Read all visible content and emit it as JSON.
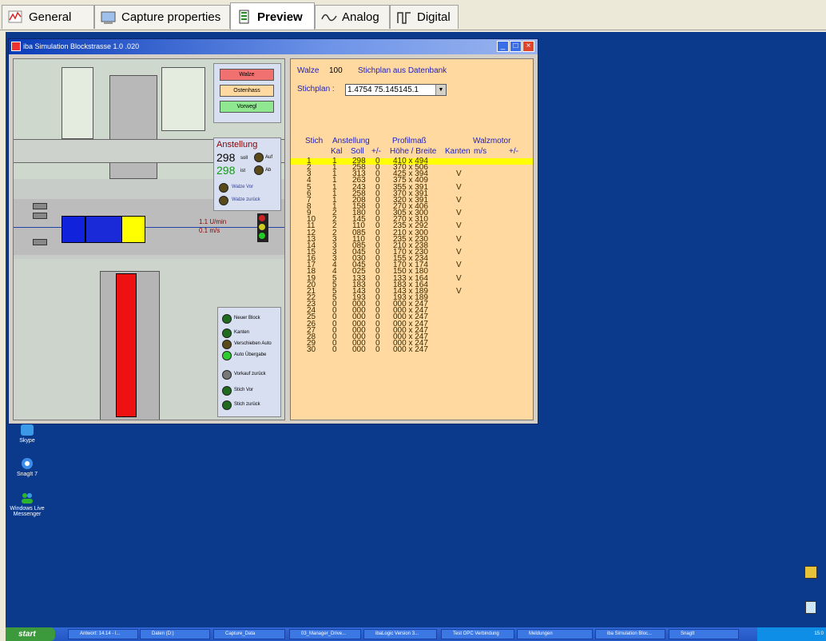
{
  "tabs": [
    {
      "label": "General",
      "icon": "general-icon"
    },
    {
      "label": "Capture properties",
      "icon": "capture-icon"
    },
    {
      "label": "Preview",
      "icon": "preview-icon",
      "active": true
    },
    {
      "label": "Analog",
      "icon": "analog-icon"
    },
    {
      "label": "Digital",
      "icon": "digital-icon"
    }
  ],
  "window": {
    "title": "iba Simulation Blockstrasse 1.0 .020"
  },
  "mill": {
    "buttons": [
      "Walze",
      "Ostenhass",
      "Vorwegl"
    ],
    "anstellung_title": "Anstellung",
    "soll_value": "298",
    "soll_label": "soll",
    "ist_value": "298",
    "ist_label": "ist",
    "auf_label": "Auf",
    "ab_label": "Ab",
    "walze_vor": "Walze Vor",
    "walze_zurueck": "Walze zurück",
    "speed_text": "1.1 U/min",
    "speed_ms": "0.1 m/s",
    "controls": [
      "Neuer Block",
      "Kanten",
      "Verschieben Auto",
      "Auto Übergabe",
      "Vorkauf zurück",
      "Stich Vor",
      "Stich zurück"
    ]
  },
  "stichplan": {
    "walze_label": "Walze",
    "walze_value": "100",
    "title": "Stichplan aus Datenbank",
    "dropdown_label": "Stichplan :",
    "dropdown_value": "1.4754 75.145145.1",
    "header1": {
      "stich": "Stich",
      "anstellung": "Anstellung",
      "profilmass": "Profilmaß",
      "walzmotor": "Walzmotor"
    },
    "header2": {
      "kal": "Kal",
      "soll": "Soll",
      "pm": "+/-",
      "hb": "Höhe / Breite",
      "kanten": "Kanten",
      "ms": "m/s",
      "pm2": "+/-"
    },
    "rows": [
      [
        "1",
        "1",
        "298",
        "0",
        "410 x 494",
        ""
      ],
      [
        "2",
        "1",
        "258",
        "0",
        "370 x 506",
        ""
      ],
      [
        "3",
        "1",
        "313",
        "0",
        "425 x 394",
        "V"
      ],
      [
        "4",
        "1",
        "263",
        "0",
        "375 x 409",
        ""
      ],
      [
        "5",
        "1",
        "243",
        "0",
        "355 x 391",
        "V"
      ],
      [
        "6",
        "1",
        "258",
        "0",
        "370 x 391",
        ""
      ],
      [
        "7",
        "1",
        "208",
        "0",
        "320 x 391",
        "V"
      ],
      [
        "8",
        "1",
        "158",
        "0",
        "270 x 406",
        ""
      ],
      [
        "9",
        "2",
        "180",
        "0",
        "305 x 300",
        "V"
      ],
      [
        "10",
        "2",
        "145",
        "0",
        "270 x 310",
        ""
      ],
      [
        "11",
        "2",
        "110",
        "0",
        "235 x 292",
        "V"
      ],
      [
        "12",
        "2",
        "085",
        "0",
        "210 x 300",
        ""
      ],
      [
        "13",
        "3",
        "110",
        "0",
        "235 x 230",
        "V"
      ],
      [
        "14",
        "3",
        "085",
        "0",
        "210 x 238",
        ""
      ],
      [
        "15",
        "3",
        "045",
        "0",
        "170 x 230",
        "V"
      ],
      [
        "16",
        "3",
        "030",
        "0",
        "155 x 234",
        ""
      ],
      [
        "17",
        "4",
        "045",
        "0",
        "170 x 174",
        "V"
      ],
      [
        "18",
        "4",
        "025",
        "0",
        "150 x 180",
        ""
      ],
      [
        "19",
        "5",
        "133",
        "0",
        "133 x 164",
        "V"
      ],
      [
        "20",
        "5",
        "183",
        "0",
        "183 x 164",
        ""
      ],
      [
        "21",
        "5",
        "143",
        "0",
        "143 x 189",
        "V"
      ],
      [
        "22",
        "5",
        "193",
        "0",
        "193 x 189",
        ""
      ],
      [
        "23",
        "0",
        "000",
        "0",
        "000 x 247",
        ""
      ],
      [
        "24",
        "0",
        "000",
        "0",
        "000 x 247",
        ""
      ],
      [
        "25",
        "0",
        "000",
        "0",
        "000 x 247",
        ""
      ],
      [
        "26",
        "0",
        "000",
        "0",
        "000 x 247",
        ""
      ],
      [
        "27",
        "0",
        "000",
        "0",
        "000 x 247",
        ""
      ],
      [
        "28",
        "0",
        "000",
        "0",
        "000 x 247",
        ""
      ],
      [
        "29",
        "0",
        "000",
        "0",
        "000 x 247",
        ""
      ],
      [
        "30",
        "0",
        "000",
        "0",
        "000 x 247",
        ""
      ]
    ]
  },
  "desktop_icons": [
    {
      "label": "Skype",
      "icon": "skype-icon"
    },
    {
      "label": "SnagIt 7",
      "icon": "snagit-icon"
    },
    {
      "label": "Windows Live Messenger",
      "icon": "messenger-icon"
    }
  ],
  "taskbar": {
    "start": "start",
    "items": [
      "Antwort: 14.14 - l...",
      "Daten (D:)",
      "Capture_Data",
      "03_Manager_Drive...",
      "ibaLogic Version 3...",
      "Test OPC Verbindung",
      "Meldungen",
      "iba Simulation Bloc...",
      "SnagIt"
    ],
    "clock": "15:0"
  },
  "colors": {
    "desktop": "#0b3a8c",
    "highlight": "#ffff00",
    "table_bg": "#ffd9a0"
  }
}
